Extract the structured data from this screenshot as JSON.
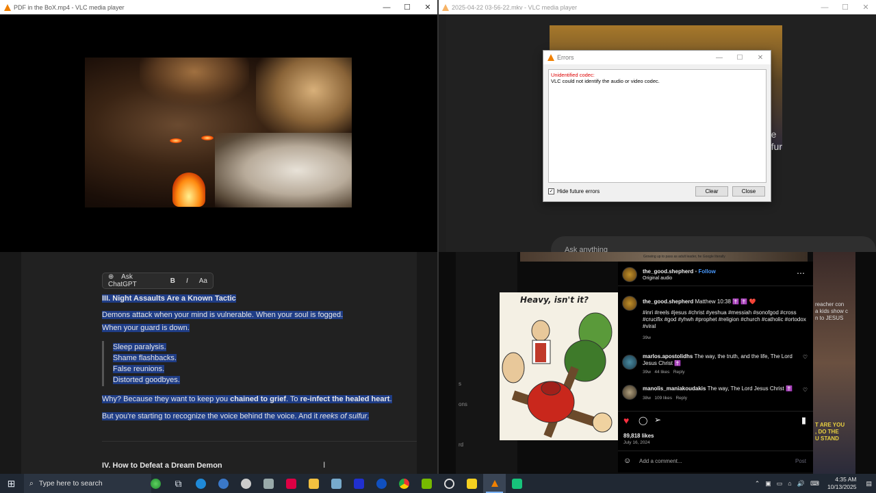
{
  "q1": {
    "title": "PDF in the BoX.mp4 - VLC media player",
    "controls": [
      "—",
      "☐",
      "✕"
    ]
  },
  "q2": {
    "title": "2025-04-22 03-56-22.mkv - VLC media player",
    "chat_img_text": "e\nfur",
    "ask_placeholder": "Ask anything",
    "errors": {
      "title": "Errors",
      "line1": "Unidentified codec:",
      "line2": "VLC could not identify the audio or video codec.",
      "hide_label": "Hide future errors",
      "clear_label": "Clear",
      "close_label": "Close"
    }
  },
  "q3": {
    "toolbar": {
      "ask": "Ask ChatGPT",
      "bold": "B",
      "italic": "I",
      "font": "Aa"
    },
    "heading3": "III. Night Assaults Are a Known Tactic",
    "p1a": "Demons attack when your mind is vulnerable. When your soul is fogged.",
    "p1b": "When your guard is down.",
    "list": [
      "Sleep paralysis.",
      "Shame flashbacks.",
      "False reunions.",
      "Distorted goodbyes."
    ],
    "p2a": "Why? Because they want to keep you ",
    "p2b": "chained to grief",
    "p2c": ". To ",
    "p2d": "re-infect the healed heart",
    "p2e": ".",
    "p3a": "But you're starting to recognize the voice behind the voice. And it ",
    "p3b": "reeks of sulfur",
    "p3c": ".",
    "heading4": "IV. How to Defeat a Dream Demon"
  },
  "q4": {
    "comic_title": "Heavy, isn't it?",
    "side_left": [
      "s",
      "ons",
      "rd"
    ],
    "side_right_top": "reacher con\na kids show c\nn to JESUS",
    "side_right_bottom": "T ARE YOU\n, DO THE\nU STAND",
    "strip_text": "Growing up to pass as adult leader, he Google literally",
    "ig": {
      "user": "the_good.shepherd",
      "follow": "Follow",
      "audio": "Original audio",
      "caption_ref": "Matthew 10:38 ✝️ ✝️ ❤️",
      "hashtags": "#inri #reels #jesus #christ #yeshua #messiah #sonofgod #cross #crucifix #god #yhwh #prophet #religion #church #catholic #ortodox #viral",
      "caption_age": "39w",
      "comments": [
        {
          "user": "marlos.apostolidhs",
          "text": "The way, the truth, and the life, The Lord Jesus Christ ✝️",
          "age": "39w",
          "likes": "44 likes",
          "reply": "Reply"
        },
        {
          "user": "manolis_maniakoudakis",
          "text": "The way, The Lord Jesus Christ ✝️",
          "age": "38w",
          "likes": "109 likes",
          "reply": "Reply"
        }
      ],
      "likes": "89,818 likes",
      "date": "July 16, 2024",
      "add_comment": "Add a comment...",
      "post": "Post"
    }
  },
  "taskbar": {
    "search_placeholder": "Type here to search",
    "time": "4:35 AM",
    "date": "10/13/2025"
  },
  "colors": {
    "selection": "#1f3d86",
    "taskbar": "#202833",
    "vlc_orange": "#f08000",
    "follow_blue": "#4a9bff",
    "error_red": "#dd0000"
  }
}
